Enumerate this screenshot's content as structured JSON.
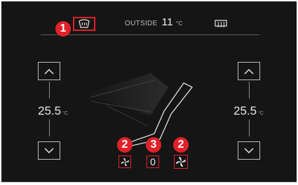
{
  "header": {
    "outside_label": "OUTSIDE",
    "outside_value": "11",
    "outside_unit": "°C"
  },
  "climate": {
    "left_temp": "25.5",
    "right_temp": "25.5",
    "temp_unit": "°C",
    "fan_level": "0"
  },
  "callouts": {
    "front_defrost": "1",
    "left_fan": "2",
    "right_fan": "2",
    "fan_level": "3"
  },
  "icons": {
    "front_defrost": "front-defrost-icon",
    "rear_defrost": "rear-defrost-icon",
    "fan": "fan-icon",
    "up": "chevron-up-icon",
    "down": "chevron-down-icon",
    "seat": "seat-outline-icon"
  },
  "colors": {
    "background": "#151515",
    "highlight": "#e0212a",
    "text": "#e6e6e6"
  }
}
